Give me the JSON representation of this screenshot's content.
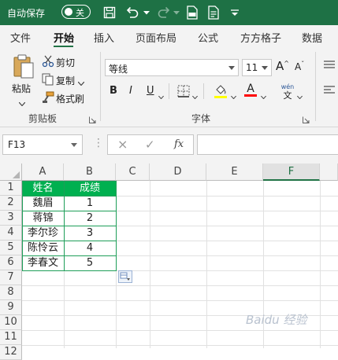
{
  "titlebar": {
    "autosave_label": "自动保存",
    "autosave_state": "关",
    "background_color": "#1e7145"
  },
  "tabs": [
    {
      "label": "文件"
    },
    {
      "label": "开始",
      "active": true
    },
    {
      "label": "插入"
    },
    {
      "label": "页面布局"
    },
    {
      "label": "公式"
    },
    {
      "label": "方方格子"
    },
    {
      "label": "数据"
    }
  ],
  "ribbon": {
    "clipboard": {
      "paste_label": "粘贴",
      "cut_label": "剪切",
      "copy_label": "复制",
      "format_painter_label": "格式刷",
      "group_label": "剪贴板"
    },
    "font": {
      "font_name": "等线",
      "font_size": "11",
      "grow_label": "A",
      "shrink_label": "A",
      "bold_label": "B",
      "italic_label": "I",
      "underline_label": "U",
      "font_color_label": "A",
      "phonetic_label": "wén",
      "phonetic_sub": "文",
      "group_label": "字体",
      "highlight_color": "#ffff00",
      "font_color": "#ff0000"
    }
  },
  "formula_bar": {
    "name_box": "F13",
    "cancel_icon": "×",
    "enter_icon": "✓",
    "fx_label": "fx",
    "formula": ""
  },
  "sheet": {
    "columns": [
      "A",
      "B",
      "C",
      "D",
      "E",
      "F"
    ],
    "selected_column": "F",
    "rows": [
      "1",
      "2",
      "3",
      "4",
      "5",
      "6",
      "7",
      "8",
      "9",
      "10",
      "11",
      "12"
    ],
    "header_fill": "#00b050",
    "table": {
      "headers": [
        "姓名",
        "成绩"
      ],
      "records": [
        [
          "魏眉",
          "1"
        ],
        [
          "蒋锦",
          "2"
        ],
        [
          "李尔珍",
          "3"
        ],
        [
          "陈怜云",
          "4"
        ],
        [
          "李春文",
          "5"
        ]
      ]
    },
    "watermark": "Baidu 经验"
  }
}
